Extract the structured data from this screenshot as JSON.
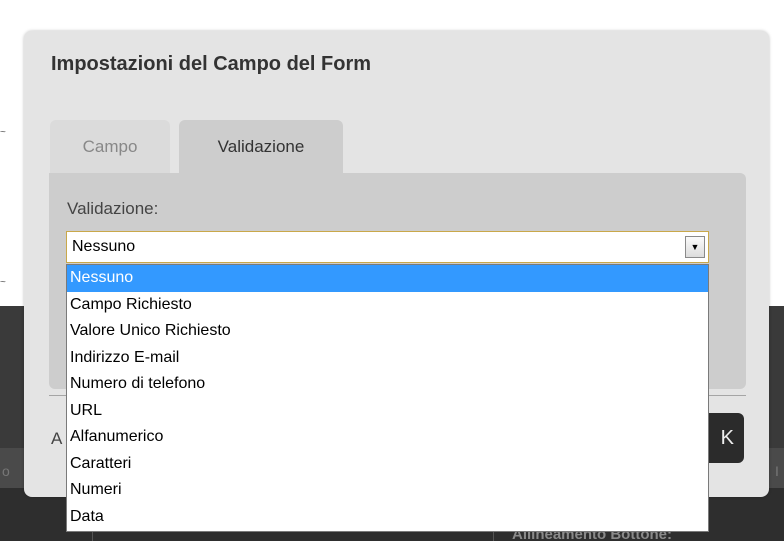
{
  "dialog": {
    "title": "Impostazioni del Campo del Form",
    "tabs": [
      {
        "label": "Campo",
        "active": false
      },
      {
        "label": "Validazione",
        "active": true
      }
    ],
    "validation_label": "Validazione:",
    "footer_partial_text": "A",
    "ok_button_partial": "K"
  },
  "select": {
    "value": "Nessuno",
    "options": [
      "Nessuno",
      "Campo Richiesto",
      "Valore Unico Richiesto",
      "Indirizzo E-mail",
      "Numero di telefono",
      "URL",
      "Alfanumerico",
      "Caratteri",
      "Numeri",
      "Data"
    ],
    "highlighted_index": 0
  },
  "background": {
    "left_edge_text": "o",
    "right_edge_text": "I",
    "bottom_heading": "Allineamento Bottone:"
  },
  "colors": {
    "highlight": "#3399ff",
    "dialog_bg": "#e4e4e4",
    "panel_bg": "#cdcdcd"
  }
}
